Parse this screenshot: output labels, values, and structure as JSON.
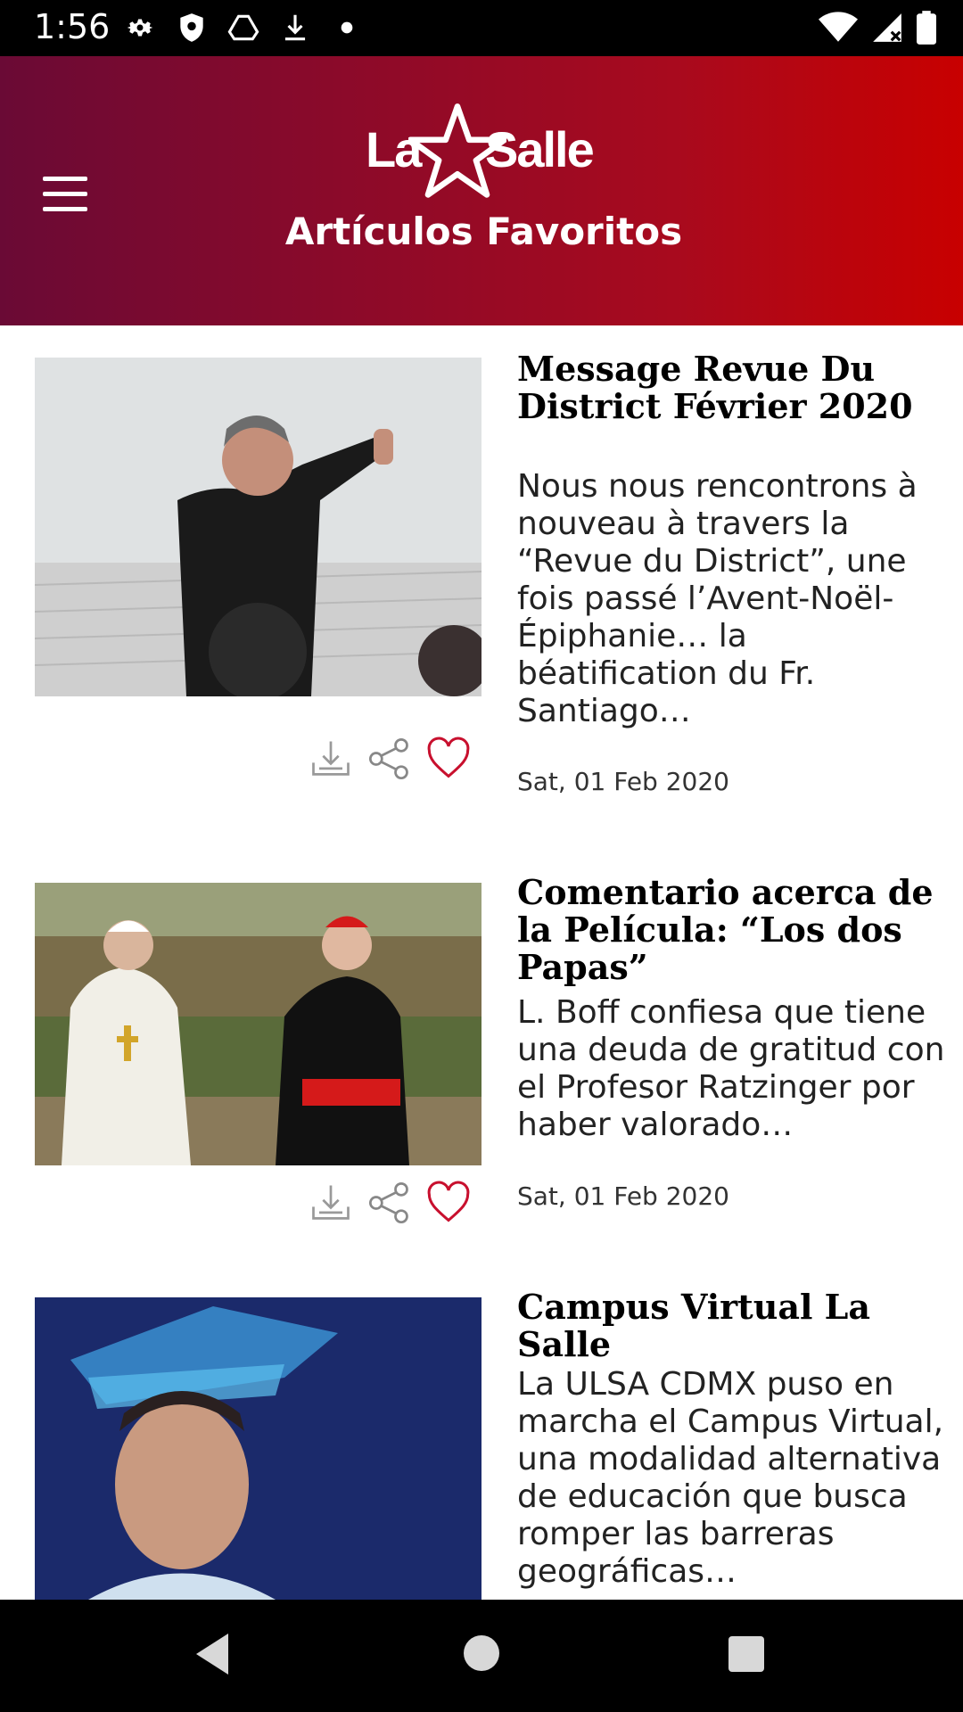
{
  "status_bar": {
    "time": "1:56",
    "icons": [
      "settings-icon",
      "shield-icon",
      "drive-icon",
      "download-icon",
      "dot-icon",
      "wifi-icon",
      "signal-icon",
      "battery-icon"
    ]
  },
  "header": {
    "logo_left": "La",
    "logo_right": "Salle",
    "title": "Artículos Favoritos",
    "menu_icon": "hamburger-icon",
    "gradient_start": "#6a0a35",
    "gradient_end": "#c80000"
  },
  "articles": [
    {
      "title": "Message Revue Du District Février 2020",
      "excerpt": "Nous nous rencontrons à nouveau à travers la “Revue du District”, une fois passé l’Avent-Noël- Épiphanie… la béatification du Fr. Santiago…",
      "date": "Sat, 01 Feb 2020",
      "favorite": true
    },
    {
      "title": "Comentario acerca de la Película: “Los dos Papas”",
      "excerpt": "L. Boff confiesa que tiene una deuda de gratitud con el Profesor Ratzinger por haber valorado…",
      "date": "Sat, 01 Feb 2020",
      "favorite": true
    },
    {
      "title": "Campus Virtual La Salle",
      "excerpt": "La ULSA CDMX puso en marcha el Campus Virtual, una modalidad alternativa de educación que busca romper las barreras geográficas…",
      "date": "",
      "favorite": true
    }
  ],
  "colors": {
    "favorite": "#c8102e",
    "icon_gray": "#888888"
  }
}
